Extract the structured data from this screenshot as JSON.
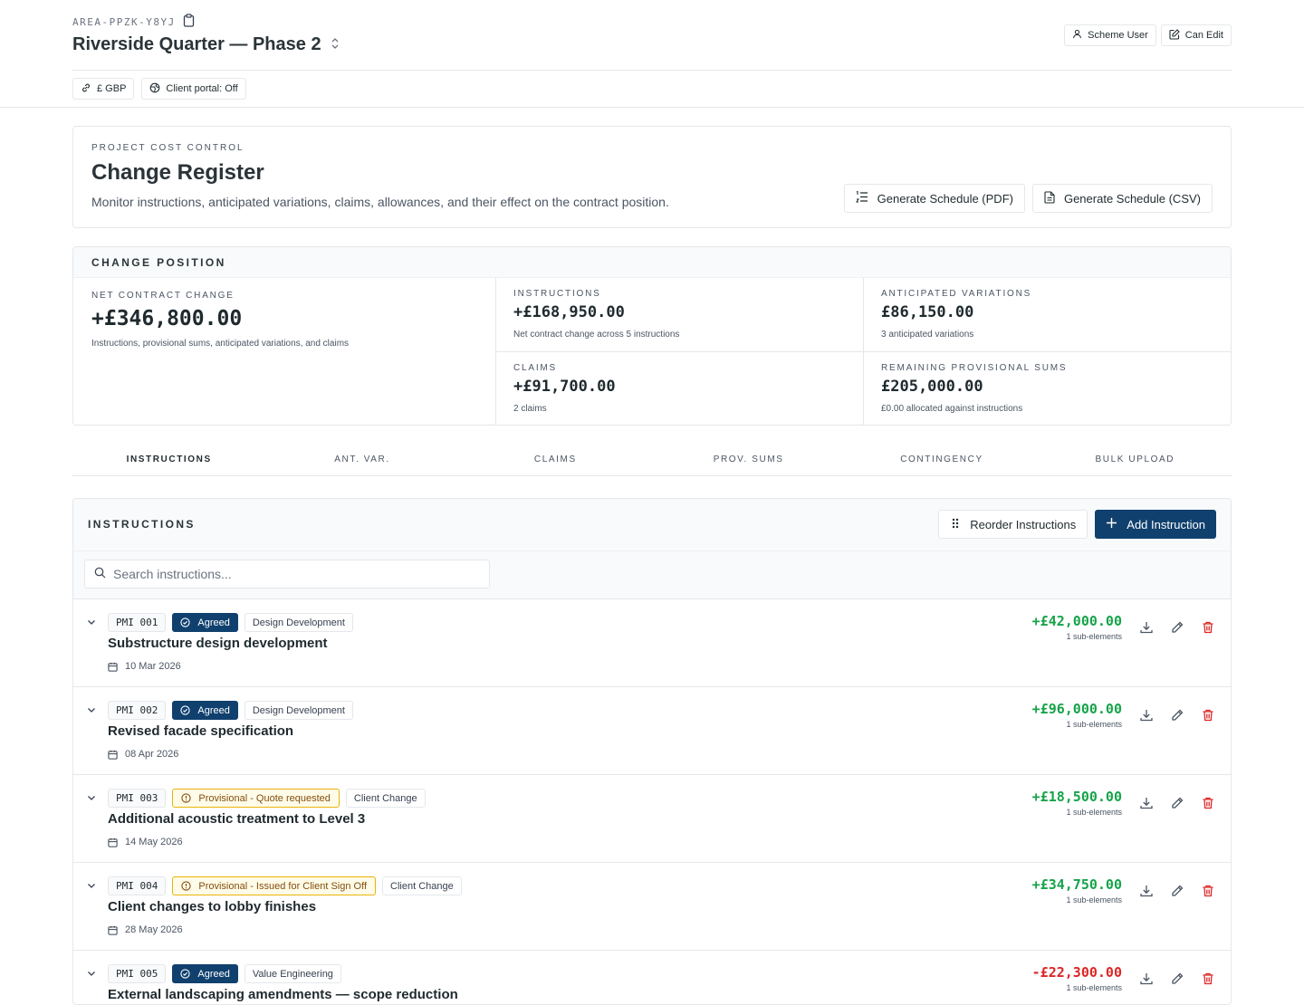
{
  "header": {
    "area_code": "AREA-PPZK-Y8YJ",
    "project_title": "Riverside Quarter — Phase 2",
    "scheme_user_label": "Scheme User",
    "can_edit_label": "Can Edit",
    "currency_label": "£ GBP",
    "client_portal_label": "Client portal: Off"
  },
  "intro": {
    "eyebrow": "PROJECT COST CONTROL",
    "title": "Change Register",
    "description": "Monitor instructions, anticipated variations, claims, allowances, and their effect on the contract position.",
    "pdf_button": "Generate Schedule (PDF)",
    "csv_button": "Generate Schedule (CSV)"
  },
  "position": {
    "heading": "CHANGE POSITION",
    "net": {
      "label": "NET CONTRACT CHANGE",
      "value": "+£346,800.00",
      "sub": "Instructions, provisional sums, anticipated variations, and claims"
    },
    "instructions": {
      "label": "INSTRUCTIONS",
      "value": "+£168,950.00",
      "sub": "Net contract change across 5 instructions"
    },
    "anticipated": {
      "label": "ANTICIPATED VARIATIONS",
      "value": "£86,150.00",
      "sub": "3 anticipated variations"
    },
    "claims": {
      "label": "CLAIMS",
      "value": "+£91,700.00",
      "sub": "2 claims"
    },
    "provisional": {
      "label": "REMAINING PROVISIONAL SUMS",
      "value": "£205,000.00",
      "sub": "£0.00 allocated against instructions"
    }
  },
  "tabs": [
    "INSTRUCTIONS",
    "ANT. VAR.",
    "CLAIMS",
    "PROV. SUMS",
    "CONTINGENCY",
    "BULK UPLOAD"
  ],
  "instructions_panel": {
    "heading": "INSTRUCTIONS",
    "reorder_label": "Reorder Instructions",
    "add_label": "Add Instruction",
    "search_placeholder": "Search instructions..."
  },
  "rows": [
    {
      "id": "PMI 001",
      "status": "Agreed",
      "category": "Design Development",
      "title": "Substructure design development",
      "date": "10 Mar 2026",
      "amount": "+£42,000.00",
      "sub": "1 sub-elements"
    },
    {
      "id": "PMI 002",
      "status": "Agreed",
      "category": "Design Development",
      "title": "Revised facade specification",
      "date": "08 Apr 2026",
      "amount": "+£96,000.00",
      "sub": "1 sub-elements"
    },
    {
      "id": "PMI 003",
      "status": "Provisional - Quote requested",
      "category": "Client Change",
      "title": "Additional acoustic treatment to Level 3",
      "date": "14 May 2026",
      "amount": "+£18,500.00",
      "sub": "1 sub-elements"
    },
    {
      "id": "PMI 004",
      "status": "Provisional - Issued for Client Sign Off",
      "category": "Client Change",
      "title": "Client changes to lobby finishes",
      "date": "28 May 2026",
      "amount": "+£34,750.00",
      "sub": "1 sub-elements"
    },
    {
      "id": "PMI 005",
      "status": "Agreed",
      "category": "Value Engineering",
      "title": "External landscaping amendments — scope reduction",
      "date": "",
      "amount": "-£22,300.00",
      "sub": "1 sub-elements"
    }
  ],
  "colors": {
    "primary": "#10406e",
    "positive": "#16a34a",
    "negative": "#dc2626",
    "provisional_border": "#eab308"
  }
}
